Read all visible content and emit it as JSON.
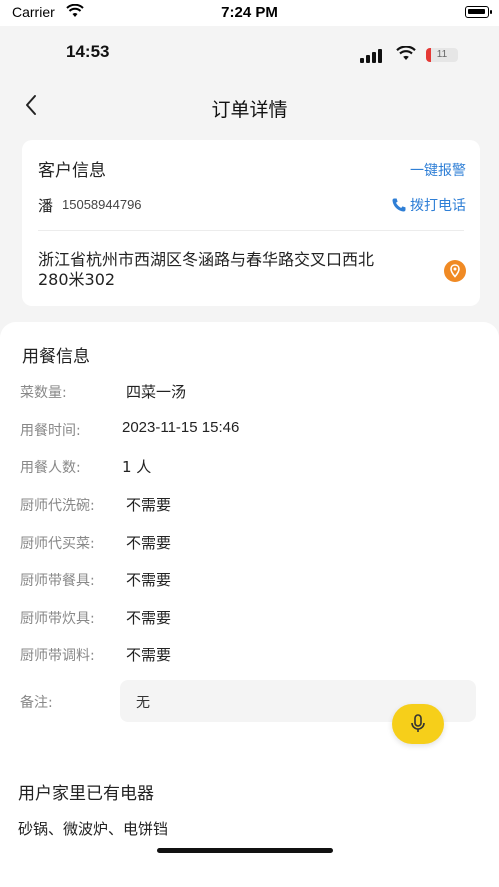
{
  "sim_status": {
    "carrier": "Carrier",
    "time": "7:24 PM"
  },
  "device_status": {
    "time": "14:53",
    "battery": "11"
  },
  "nav": {
    "title": "订单详情"
  },
  "customer": {
    "section_title": "客户信息",
    "alarm_label": "一键报警",
    "name": "潘",
    "phone": "15058944796",
    "call_label": "拨打电话",
    "address_line1": "浙江省杭州市西湖区冬涵路与春华路交叉口西北",
    "address_line2": "280米302"
  },
  "meal": {
    "section_title": "用餐信息",
    "rows": [
      {
        "label": "菜数量:",
        "value": "四菜一汤"
      },
      {
        "label": "用餐时间:",
        "value": "2023-11-15 15:46"
      },
      {
        "label": "用餐人数:",
        "value": "1 人"
      },
      {
        "label": "厨师代洗碗:",
        "value": "不需要"
      },
      {
        "label": "厨师代买菜:",
        "value": "不需要"
      },
      {
        "label": "厨师带餐具:",
        "value": "不需要"
      },
      {
        "label": "厨师带炊具:",
        "value": "不需要"
      },
      {
        "label": "厨师带调料:",
        "value": "不需要"
      }
    ],
    "remark_label": "备注:",
    "remark_value": "无"
  },
  "appliances": {
    "section_title": "用户家里已有电器",
    "list": "砂锅、微波炉、电饼铛"
  },
  "colors": {
    "link_blue": "#2f7fd6",
    "accent_yellow": "#f6cf1a",
    "location_orange": "#f08a24",
    "battery_red": "#e53935"
  },
  "icons": [
    "wifi-icon",
    "signal-icon",
    "battery-icon",
    "back-chevron-icon",
    "phone-icon",
    "location-pin-icon",
    "microphone-icon"
  ]
}
